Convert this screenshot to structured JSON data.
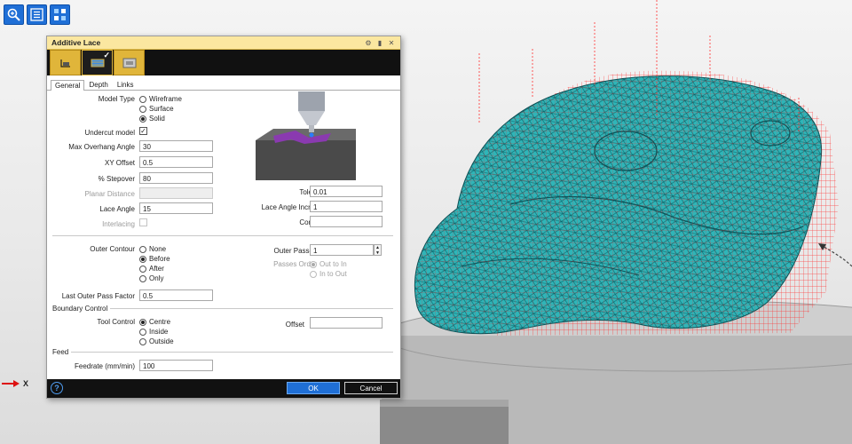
{
  "dialog": {
    "title": "Additive Lace",
    "tabs": [
      "General",
      "Depth",
      "Links"
    ],
    "ok_label": "OK",
    "cancel_label": "Cancel",
    "help_label": "?"
  },
  "axis_label": "X",
  "general": {
    "model_type_label": "Model Type",
    "model_type_options": [
      "Wireframe",
      "Surface",
      "Solid"
    ],
    "model_type_selected": "Solid",
    "undercut_label": "Undercut model",
    "undercut_checked": true,
    "max_overhang_label": "Max Overhang Angle",
    "max_overhang_value": "30",
    "xy_offset_label": "XY Offset",
    "xy_offset_value": "0.5",
    "stepover_label": "% Stepover",
    "stepover_value": "80",
    "planar_distance_label": "Planar Distance",
    "planar_distance_value": "",
    "lace_angle_label": "Lace Angle",
    "lace_angle_value": "15",
    "interlacing_label": "Interlacing",
    "tolerance_label": "Tolerance",
    "tolerance_value": "0.01",
    "lace_angle_increment_label": "Lace Angle Increment",
    "lace_angle_increment_value": "1",
    "comment_label": "Comment",
    "comment_value": "",
    "outer_contour_label": "Outer Contour",
    "outer_contour_options": [
      "None",
      "Before",
      "After",
      "Only"
    ],
    "outer_contour_selected": "Before",
    "outer_passes_label": "Outer Passes",
    "outer_passes_value": "1",
    "passes_order_label": "Passes Order",
    "passes_order_options": [
      "Out to In",
      "In to Out"
    ],
    "passes_order_selected": "Out to In",
    "last_outer_label": "Last Outer Pass Factor",
    "last_outer_value": "0.5",
    "boundary_section": "Boundary Control",
    "tool_control_label": "Tool Control",
    "tool_control_options": [
      "Centre",
      "Inside",
      "Outside"
    ],
    "tool_control_selected": "Centre",
    "offset_label": "Offset",
    "offset_value": "",
    "feed_section": "Feed",
    "feedrate_label": "Feedrate (mm/min)",
    "feedrate_value": "100"
  },
  "colors": {
    "accent_blue": "#1f6fd6",
    "title_yellow": "#fbe7a0",
    "toolbar_gold": "#e0b53a",
    "model_teal": "#2fb5b8",
    "toolpath_red": "#ff2020"
  },
  "icons": {
    "top": [
      "zoom-icon",
      "list-icon",
      "grid-icon"
    ],
    "toolbar": [
      "layer-icon",
      "stack-icon",
      "preview-icon"
    ]
  }
}
